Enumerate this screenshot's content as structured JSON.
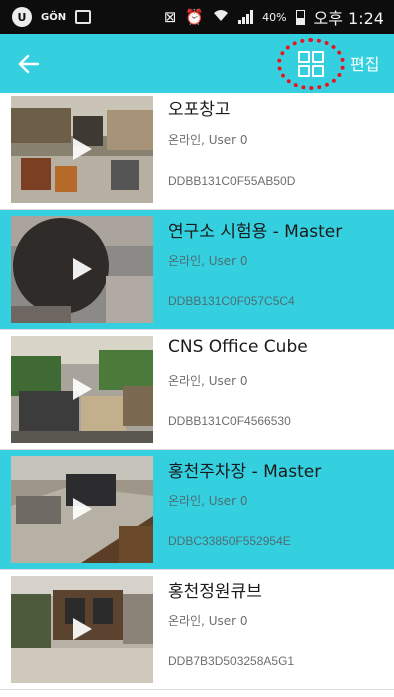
{
  "status_bar": {
    "carrier": "GÖN",
    "battery": "40%",
    "battery_level": 0.4,
    "time": "오후 1:24"
  },
  "app_bar": {
    "back_icon": "arrow-left-icon",
    "grid_icon": "grid-view-icon",
    "edit_label": "편집",
    "accent_color": "#35d0e0",
    "highlight_color": "#e8141b"
  },
  "devices": [
    {
      "name": "오포창고",
      "status": "온라인, User 0",
      "serial": "DDBB131C0F55AB50D",
      "selected": false
    },
    {
      "name": "연구소 시험용 - Master",
      "status": "온라인, User 0",
      "serial": "DDBB131C0F057C5C4",
      "selected": true
    },
    {
      "name": "CNS Office Cube",
      "status": "온라인, User 0",
      "serial": "DDBB131C0F4566530",
      "selected": false
    },
    {
      "name": "홍천주차장 - Master",
      "status": "온라인, User 0",
      "serial": "DDBC33850F552954E",
      "selected": true
    },
    {
      "name": "홍천정원큐브",
      "status": "온라인, User 0",
      "serial": "DDB7B3D503258A5G1",
      "selected": false
    }
  ]
}
